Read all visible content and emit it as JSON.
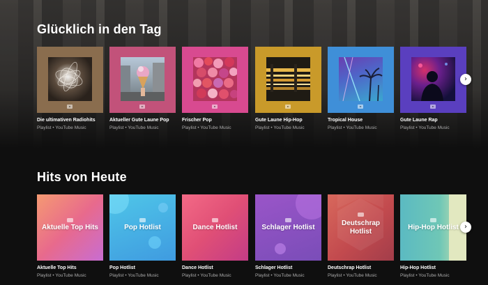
{
  "sections": [
    {
      "title": "Glücklich in den Tag",
      "cards": [
        {
          "title": "Die ultimativen Radiohits",
          "subtitle": "Playlist • YouTube Music"
        },
        {
          "title": "Aktueller Gute Laune Pop",
          "subtitle": "Playlist • YouTube Music"
        },
        {
          "title": "Frischer Pop",
          "subtitle": "Playlist • YouTube Music"
        },
        {
          "title": "Gute Laune Hip-Hop",
          "subtitle": "Playlist • YouTube Music"
        },
        {
          "title": "Tropical House",
          "subtitle": "Playlist • YouTube Music"
        },
        {
          "title": "Gute Laune Rap",
          "subtitle": "Playlist • YouTube Music"
        }
      ]
    },
    {
      "title": "Hits von Heute",
      "cards": [
        {
          "title": "Aktuelle Top Hits",
          "subtitle": "Playlist • YouTube Music",
          "art_text": "Aktuelle Top Hits"
        },
        {
          "title": "Pop Hotlist",
          "subtitle": "Playlist • YouTube Music",
          "art_text": "Pop Hotlist"
        },
        {
          "title": "Dance Hotlist",
          "subtitle": "Playlist • YouTube Music",
          "art_text": "Dance Hotlist"
        },
        {
          "title": "Schlager Hotlist",
          "subtitle": "Playlist • YouTube Music",
          "art_text": "Schlager Hotlist"
        },
        {
          "title": "Deutschrap Hotlist",
          "subtitle": "Playlist • YouTube Music",
          "art_text": "Deutschrap Hotlist"
        },
        {
          "title": "Hip-Hop Hotlist",
          "subtitle": "Playlist • YouTube Music",
          "art_text": "Hip-Hop Hotlist"
        }
      ]
    }
  ],
  "icons": {
    "next_arrow": "chevron-right-icon",
    "youtube_music": "youtube-music-icon"
  },
  "colors": {
    "background": "#0f0f0f",
    "text_primary": "#ffffff",
    "text_secondary": "#aaaaaa"
  }
}
